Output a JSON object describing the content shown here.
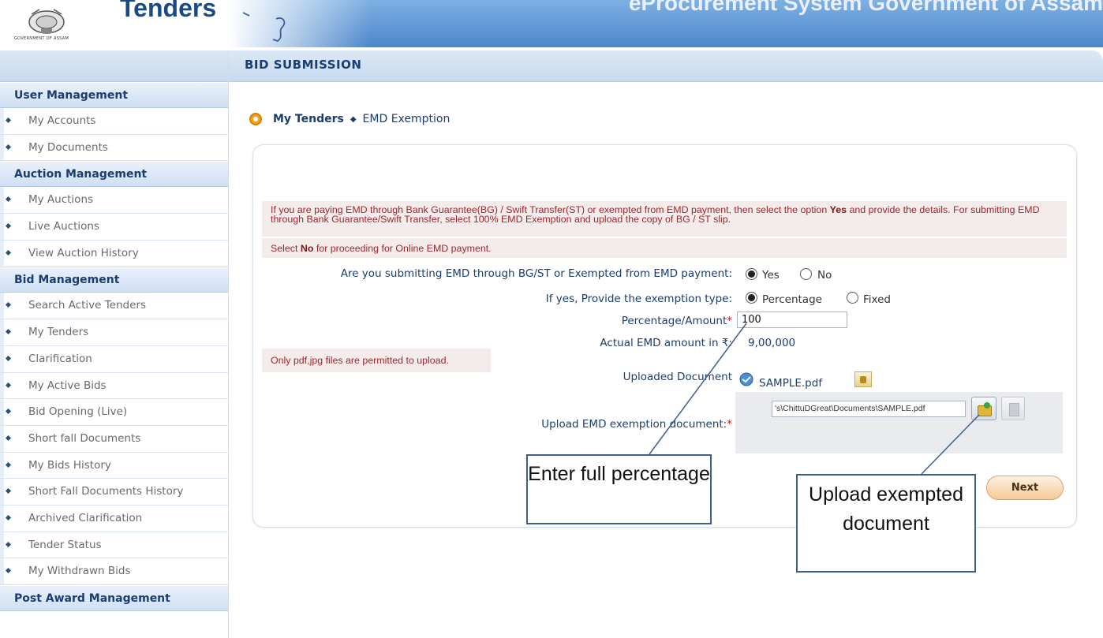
{
  "header": {
    "app_title": "Tenders",
    "system_title": "eProcurement System Government of Assam",
    "gov_label": "GOVERNMENT OF ASSAM",
    "emblem_icon": "emblem-icon",
    "map_icon": "assam-map-icon"
  },
  "sidebar": {
    "sections": [
      {
        "title": "User Management",
        "items": [
          "My Accounts",
          "My Documents"
        ]
      },
      {
        "title": "Auction Management",
        "items": [
          "My Auctions",
          "Live Auctions",
          "View Auction History"
        ]
      },
      {
        "title": "Bid Management",
        "items": [
          "Search Active Tenders",
          "My Tenders",
          "Clarification",
          "My Active Bids",
          "Bid Opening (Live)",
          "Short fall Documents",
          "My Bids History",
          "Short Fall Documents History",
          "Archived Clarification",
          "Tender Status",
          "My Withdrawn Bids"
        ]
      },
      {
        "title": "Post Award Management",
        "items": []
      }
    ]
  },
  "main": {
    "page_heading": "BID SUBMISSION",
    "breadcrumb": {
      "root": "My Tenders",
      "current": "EMD Exemption"
    },
    "notice": {
      "line1_a": "If you are paying EMD through Bank Guarantee(BG) / Swift Transfer(ST) or exempted from EMD payment, then select the option ",
      "line1_b": "Yes",
      "line1_c": " and provide the details. For submitting EMD through Bank Guarantee/Swift Transfer, select 100% EMD Exemption and upload the copy of BG / ST slip.",
      "line2_a": "Select ",
      "line2_b": "No",
      "line2_c": " for proceeding for Online EMD payment."
    },
    "form": {
      "q_submitting": "Are you submitting EMD through BG/ST or Exempted from EMD payment:",
      "opt_yes": "Yes",
      "opt_no": "No",
      "q_exemption_type": "If yes, Provide the exemption type:",
      "opt_percentage": "Percentage",
      "opt_fixed": "Fixed",
      "percent_label": "Percentage/Amount",
      "percent_value": "100",
      "actual_label": "Actual EMD amount in ₹:",
      "actual_value": "9,00,000",
      "permit_note": "Only pdf,jpg files are permitted to upload.",
      "uploaded_label": "Uploaded Document",
      "uploaded_file": "SAMPLE.pdf",
      "upload_label": "Upload EMD exemption document:",
      "upload_path": "'s\\ChittuDGreat\\Documents\\SAMPLE.pdf",
      "selected_submitting": "Yes",
      "selected_exemption_type": "Percentage"
    },
    "next_label": "Next"
  },
  "callouts": {
    "percentage": "Enter full percentage",
    "upload": "Upload exempted document"
  },
  "colors": {
    "header_blue": "#4c86cc",
    "nav_text": "#1b3d70",
    "notice_red": "#a0262e",
    "next_orange": "#f6c998"
  }
}
